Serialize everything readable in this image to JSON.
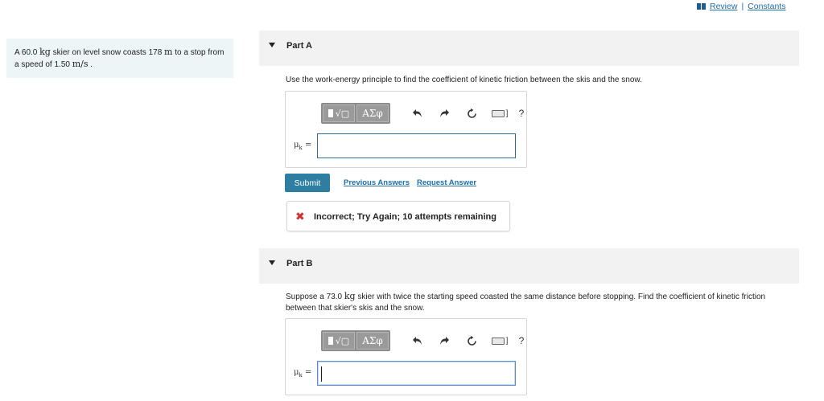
{
  "header": {
    "review_label": "Review",
    "separator": "|",
    "constants_label": "Constants"
  },
  "problem": {
    "text_1": "A 60.0 ",
    "unit_kg": "kg",
    "text_2": " skier on level snow coasts 178 ",
    "unit_m": "m",
    "text_3": " to a stop from a speed of 1.50 ",
    "unit_speed": "m/s",
    "text_4": " ."
  },
  "part_a": {
    "title": "Part A",
    "instruction": "Use the work-energy principle to find the coefficient of kinetic friction between the skis and the snow.",
    "mu_label": "μ",
    "mu_sub": "k",
    "equals": "=",
    "input_value": "",
    "submit_label": "Submit",
    "previous_answers_label": "Previous Answers",
    "request_answer_label": "Request Answer",
    "feedback_icon": "✖",
    "feedback_text": "Incorrect; Try Again; 10 attempts remaining"
  },
  "part_b": {
    "title": "Part B",
    "instruction_1": "Suppose a 73.0 ",
    "unit_kg": "kg",
    "instruction_2": " skier with twice the starting speed coasted the same distance before stopping. Find the coefficient of kinetic friction between that skier's skis and the snow.",
    "mu_label": "μ",
    "mu_sub": "k",
    "equals": "=",
    "input_value": ""
  },
  "toolbar": {
    "greek_label": "ΑΣφ",
    "radical_label": "√▢",
    "undo_icon": "undo-icon",
    "redo_icon": "redo-icon",
    "reset_icon": "reset-icon",
    "keyboard_icon": "keyboard-icon",
    "help_label": "?"
  }
}
